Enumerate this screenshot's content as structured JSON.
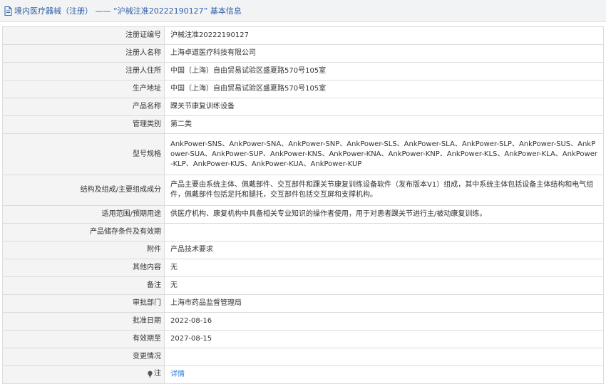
{
  "header": {
    "breadcrumb": "境内医疗器械（注册） —— “沪械注准20222190127” 基本信息"
  },
  "rows": [
    {
      "label": "注册证编号",
      "value": "沪械注准20222190127"
    },
    {
      "label": "注册人名称",
      "value": "上海卓道医疗科技有限公司"
    },
    {
      "label": "注册人住所",
      "value": "中国（上海）自由贸易试验区盛夏路570号105室"
    },
    {
      "label": "生产地址",
      "value": "中国（上海）自由贸易试验区盛夏路570号105室"
    },
    {
      "label": "产品名称",
      "value": "踝关节康复训练设备"
    },
    {
      "label": "管理类别",
      "value": "第二类"
    },
    {
      "label": "型号规格",
      "value": "AnkPower-SNS、AnkPower-SNA、AnkPower-SNP、AnkPower-SLS、AnkPower-SLA、AnkPower-SLP、AnkPower-SUS、AnkPower-SUA、AnkPower-SUP、AnkPower-KNS、AnkPower-KNA、AnkPower-KNP、AnkPower-KLS、AnkPower-KLA、AnkPower-KLP、AnkPower-KUS、AnkPower-KUA、AnkPower-KUP"
    },
    {
      "label": "结构及组成/主要组成成分",
      "value": "产品主要由系统主体、佩戴部件、交互部件和踝关节康复训练设备软件（发布版本V1）组成，其中系统主体包括设备主体结构和电气组件，佩戴部件包括足托和腿托，交互部件包括交互屏和支撑机构。"
    },
    {
      "label": "适用范围/预期用途",
      "value": "供医疗机构、康复机构中具备相关专业知识的操作者使用，用于对患者踝关节进行主/被动康复训练。"
    },
    {
      "label": "产品储存条件及有效期",
      "value": ""
    },
    {
      "label": "附件",
      "value": "产品技术要求"
    },
    {
      "label": "其他内容",
      "value": "无"
    },
    {
      "label": "备注",
      "value": "无"
    },
    {
      "label": "审批部门",
      "value": "上海市药品监督管理局"
    },
    {
      "label": "批准日期",
      "value": "2022-08-16"
    },
    {
      "label": "有效期至",
      "value": "2027-08-15"
    },
    {
      "label": "变更情况",
      "value": ""
    }
  ],
  "note": {
    "label": "注",
    "link_text": "详情"
  },
  "icons": {
    "header": "document-icon",
    "note": "lightbulb-icon"
  }
}
